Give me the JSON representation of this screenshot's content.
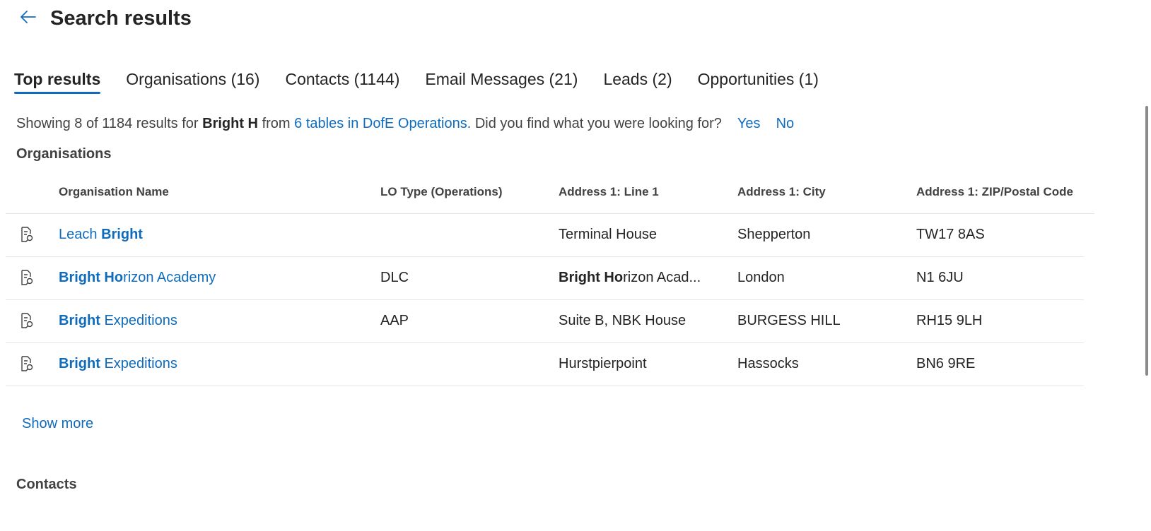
{
  "header": {
    "title": "Search results",
    "back_icon": "arrow-left-icon"
  },
  "tabs": [
    {
      "label": "Top results",
      "active": true
    },
    {
      "label": "Organisations (16)",
      "active": false
    },
    {
      "label": "Contacts (1144)",
      "active": false
    },
    {
      "label": "Email Messages (21)",
      "active": false
    },
    {
      "label": "Leads (2)",
      "active": false
    },
    {
      "label": "Opportunities (1)",
      "active": false
    }
  ],
  "summary": {
    "prefix": "Showing 8 of 1184 results for ",
    "query": "Bright H",
    "middle": " from ",
    "scope_link": "6 tables in DofE Operations.",
    "question": " Did you find what you were looking for?",
    "yes": "Yes",
    "no": "No"
  },
  "organisations": {
    "section_title": "Organisations",
    "columns": [
      "Organisation Name",
      "LO Type (Operations)",
      "Address 1: Line 1",
      "Address 1: City",
      "Address 1: ZIP/Postal Code"
    ],
    "rows": [
      {
        "name_pre": "Leach ",
        "name_bold": "Bright",
        "name_post": "",
        "lo_type": "",
        "line1_bold": "",
        "line1": "Terminal House",
        "city": "Shepperton",
        "zip": "TW17 8AS"
      },
      {
        "name_pre": "",
        "name_bold": "Bright Ho",
        "name_post": "rizon Academy",
        "lo_type": "DLC",
        "line1_bold": "Bright Ho",
        "line1": "rizon Acad...",
        "city": "London",
        "zip": "N1 6JU"
      },
      {
        "name_pre": "",
        "name_bold": "Bright",
        "name_post": " Expeditions",
        "lo_type": "AAP",
        "line1_bold": "",
        "line1": "Suite B, NBK House",
        "city": "BURGESS HILL",
        "zip": "RH15 9LH"
      },
      {
        "name_pre": "",
        "name_bold": "Bright",
        "name_post": " Expeditions",
        "lo_type": "",
        "line1_bold": "",
        "line1": "Hurstpierpoint",
        "city": "Hassocks",
        "zip": "BN6 9RE"
      }
    ],
    "show_more": "Show more"
  },
  "contacts": {
    "section_title": "Contacts"
  },
  "colors": {
    "accent": "#0f6cbd",
    "text": "#242424",
    "divider": "#e6e6e6"
  }
}
